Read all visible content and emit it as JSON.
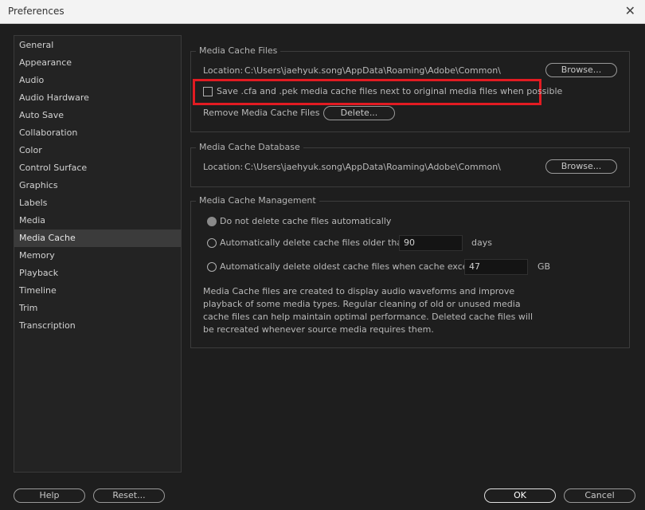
{
  "window": {
    "title": "Preferences",
    "close_glyph": "✕"
  },
  "sidebar": {
    "items": [
      {
        "label": "General"
      },
      {
        "label": "Appearance"
      },
      {
        "label": "Audio"
      },
      {
        "label": "Audio Hardware"
      },
      {
        "label": "Auto Save"
      },
      {
        "label": "Collaboration"
      },
      {
        "label": "Color"
      },
      {
        "label": "Control Surface"
      },
      {
        "label": "Graphics"
      },
      {
        "label": "Labels"
      },
      {
        "label": "Media"
      },
      {
        "label": "Media Cache"
      },
      {
        "label": "Memory"
      },
      {
        "label": "Playback"
      },
      {
        "label": "Timeline"
      },
      {
        "label": "Trim"
      },
      {
        "label": "Transcription"
      }
    ],
    "selected": "Media Cache"
  },
  "cache_files": {
    "title": "Media Cache Files",
    "location_label": "Location:",
    "location_value": "C:\\Users\\jaehyuk.song\\AppData\\Roaming\\Adobe\\Common\\",
    "browse_label": "Browse...",
    "save_next_label": "Save .cfa and .pek media cache files next to original media files when possible",
    "remove_label": "Remove Media Cache Files",
    "delete_label": "Delete..."
  },
  "cache_db": {
    "title": "Media Cache Database",
    "location_label": "Location:",
    "location_value": "C:\\Users\\jaehyuk.song\\AppData\\Roaming\\Adobe\\Common\\",
    "browse_label": "Browse..."
  },
  "cache_mgmt": {
    "title": "Media Cache Management",
    "opt_none": "Do not delete cache files automatically",
    "opt_older": "Automatically delete cache files older than:",
    "older_value": "90",
    "older_unit": "days",
    "opt_exceeds": "Automatically delete oldest cache files when cache exceeds:",
    "exceeds_value": "47",
    "exceeds_unit": "GB",
    "description": "Media Cache files are created to display audio waveforms and improve playback of some media types.  Regular cleaning of old or unused media cache files can help maintain optimal performance. Deleted cache files will be recreated whenever source media requires them."
  },
  "footer": {
    "help": "Help",
    "reset": "Reset...",
    "ok": "OK",
    "cancel": "Cancel"
  },
  "colors": {
    "highlight": "#e21b22",
    "background": "#1e1e1e"
  }
}
